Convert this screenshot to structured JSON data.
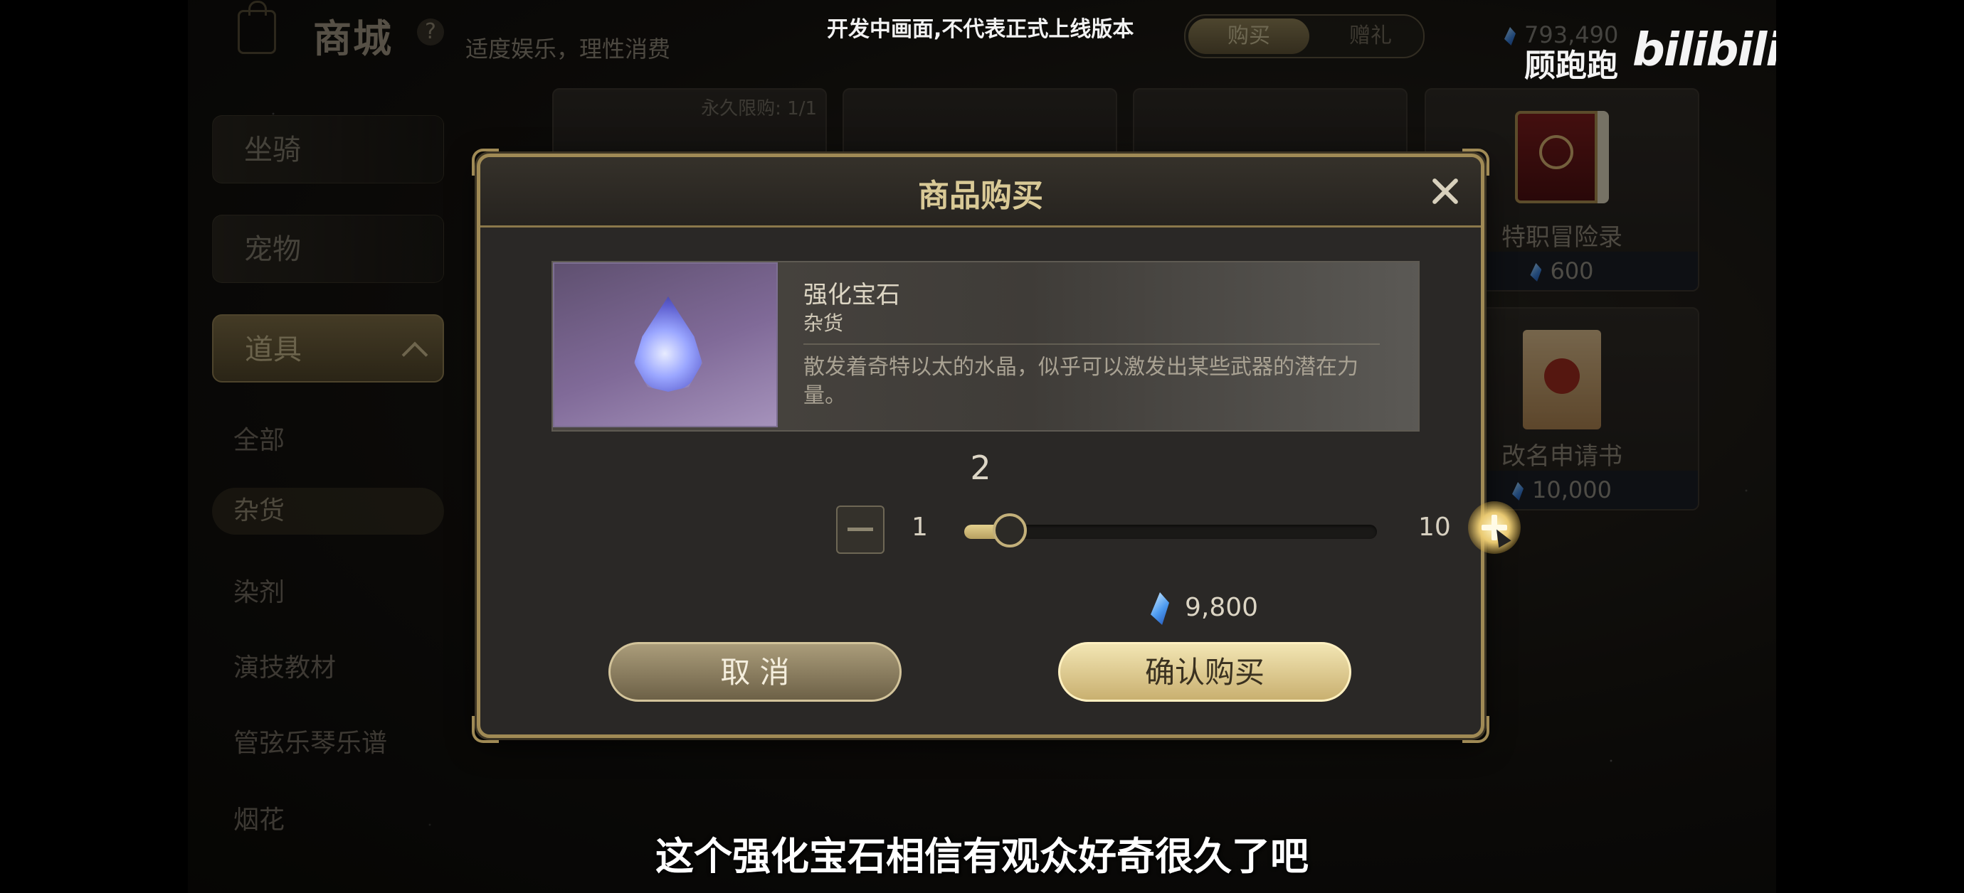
{
  "topbar": {
    "title": "商城",
    "help": "?",
    "slogan": "适度娱乐，理性消费",
    "dev_notice": "开发中画面,不代表正式上线版本",
    "tab_buy": "购买",
    "tab_gift": "赠礼",
    "currency_balance": "793,490",
    "uploader": "顾跑跑",
    "watermark": "bilibili"
  },
  "sidebar": {
    "categories": [
      {
        "label": "坐骑"
      },
      {
        "label": "宠物"
      },
      {
        "label": "道具"
      }
    ],
    "subcategories": [
      {
        "label": "全部"
      },
      {
        "label": "杂货"
      },
      {
        "label": "染剂"
      },
      {
        "label": "演技教材"
      },
      {
        "label": "管弦乐琴乐谱"
      },
      {
        "label": "烟花"
      }
    ]
  },
  "grid": {
    "limit_label": "永久限购: 1/1",
    "cards": [
      {
        "name": "特职冒险录",
        "price": "600",
        "icon": "red-book-icon"
      },
      {
        "name": "改名申请书",
        "price": "10,000",
        "icon": "rename-scroll-icon"
      }
    ]
  },
  "modal": {
    "title": "商品购买",
    "item": {
      "name": "强化宝石",
      "category": "杂货",
      "description": "散发着奇特以太的水晶，似乎可以激发出某些武器的潜在力量。",
      "icon": "enhancement-gem-icon"
    },
    "quantity": "2",
    "min": "1",
    "max": "10",
    "slider_fraction": 0.11,
    "total_price": "9,800",
    "cancel_label": "取 消",
    "confirm_label": "确认购买"
  },
  "subtitle": "这个强化宝石相信有观众好奇很久了吧",
  "colors": {
    "accent_gold": "#a08a55",
    "confirm_button": "#e3d08e",
    "gem_blue": "#4d9bf0"
  }
}
